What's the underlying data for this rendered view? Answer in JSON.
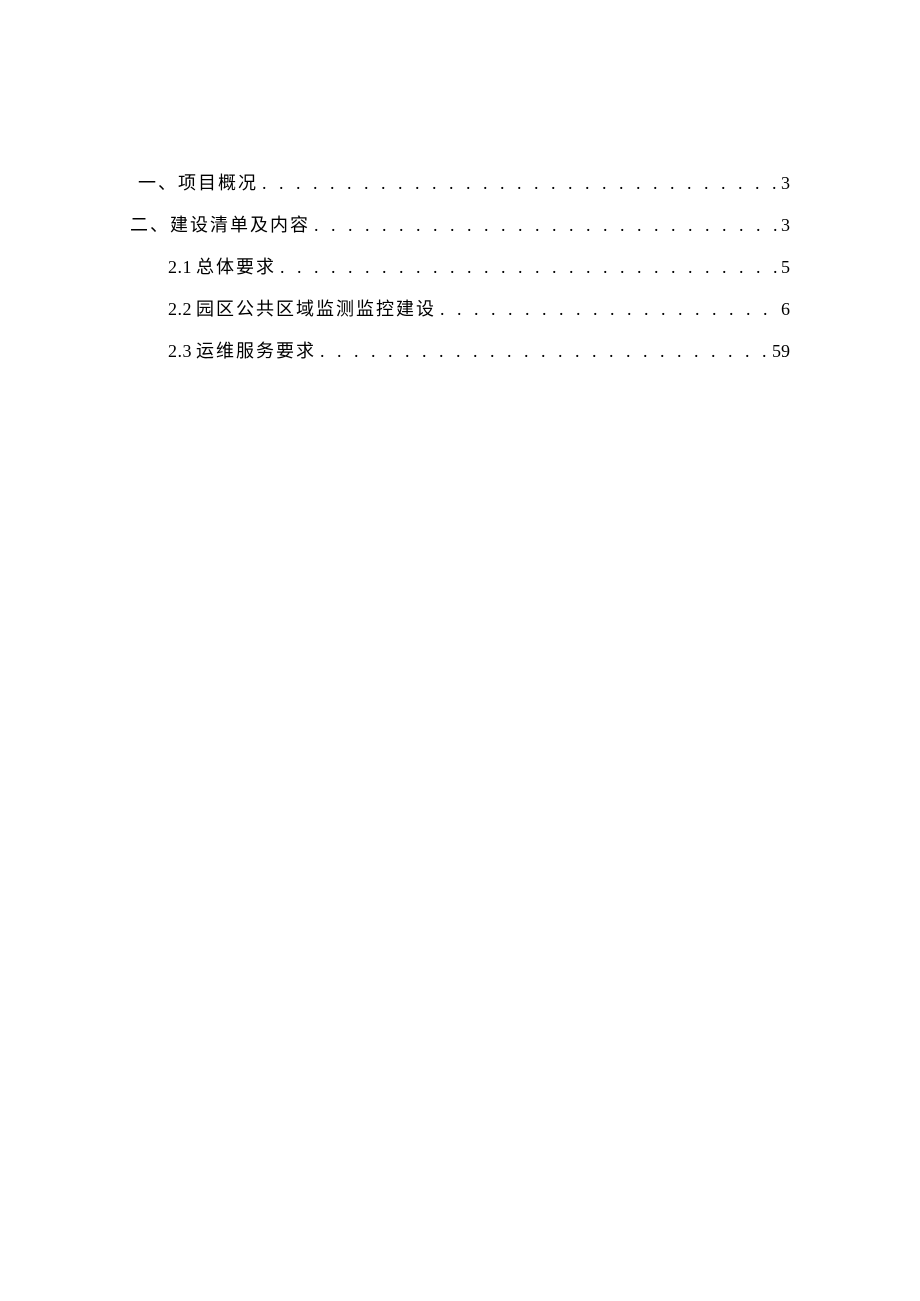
{
  "toc": {
    "items": [
      {
        "level_class": "lv1-a",
        "number": "",
        "label": "一、项目概况",
        "page": "3"
      },
      {
        "level_class": "lv1-b",
        "number": "",
        "label": "二、建设清单及内容",
        "page": "3"
      },
      {
        "level_class": "lv2",
        "number": "2.1",
        "label": "总体要求",
        "page": "5"
      },
      {
        "level_class": "lv2",
        "number": "2.2",
        "label": "园区公共区域监测监控建设",
        "page": "6"
      },
      {
        "level_class": "lv2",
        "number": "2.3",
        "label": "运维服务要求",
        "page": "59"
      }
    ]
  }
}
